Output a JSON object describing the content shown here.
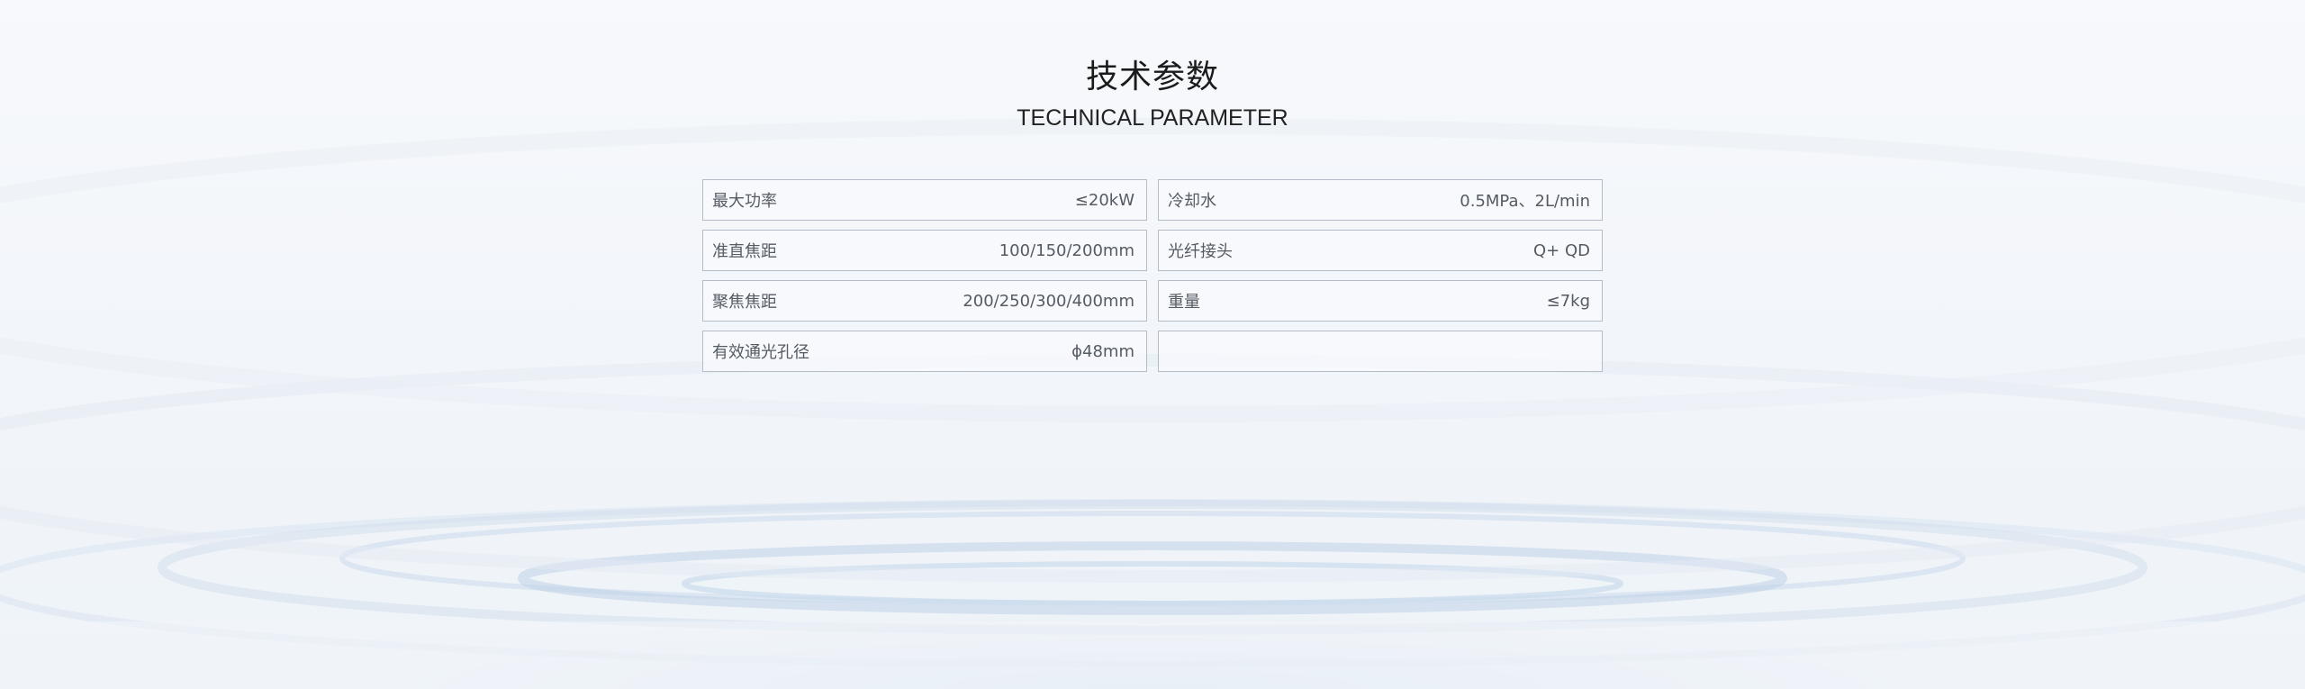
{
  "header": {
    "title_cn": "技术参数",
    "title_en": "TECHNICAL PARAMETER"
  },
  "params": [
    {
      "label": "最大功率",
      "value": "≤20kW"
    },
    {
      "label": "冷却水",
      "value": "0.5MPa、2L/min"
    },
    {
      "label": "准直焦距",
      "value": "100/150/200mm"
    },
    {
      "label": "光纤接头",
      "value": "Q+ QD"
    },
    {
      "label": "聚焦焦距",
      "value": "200/250/300/400mm"
    },
    {
      "label": "重量",
      "value": "≤7kg"
    },
    {
      "label": "有效通光孔径",
      "value": "ϕ48mm"
    },
    {
      "label": "",
      "value": ""
    }
  ]
}
